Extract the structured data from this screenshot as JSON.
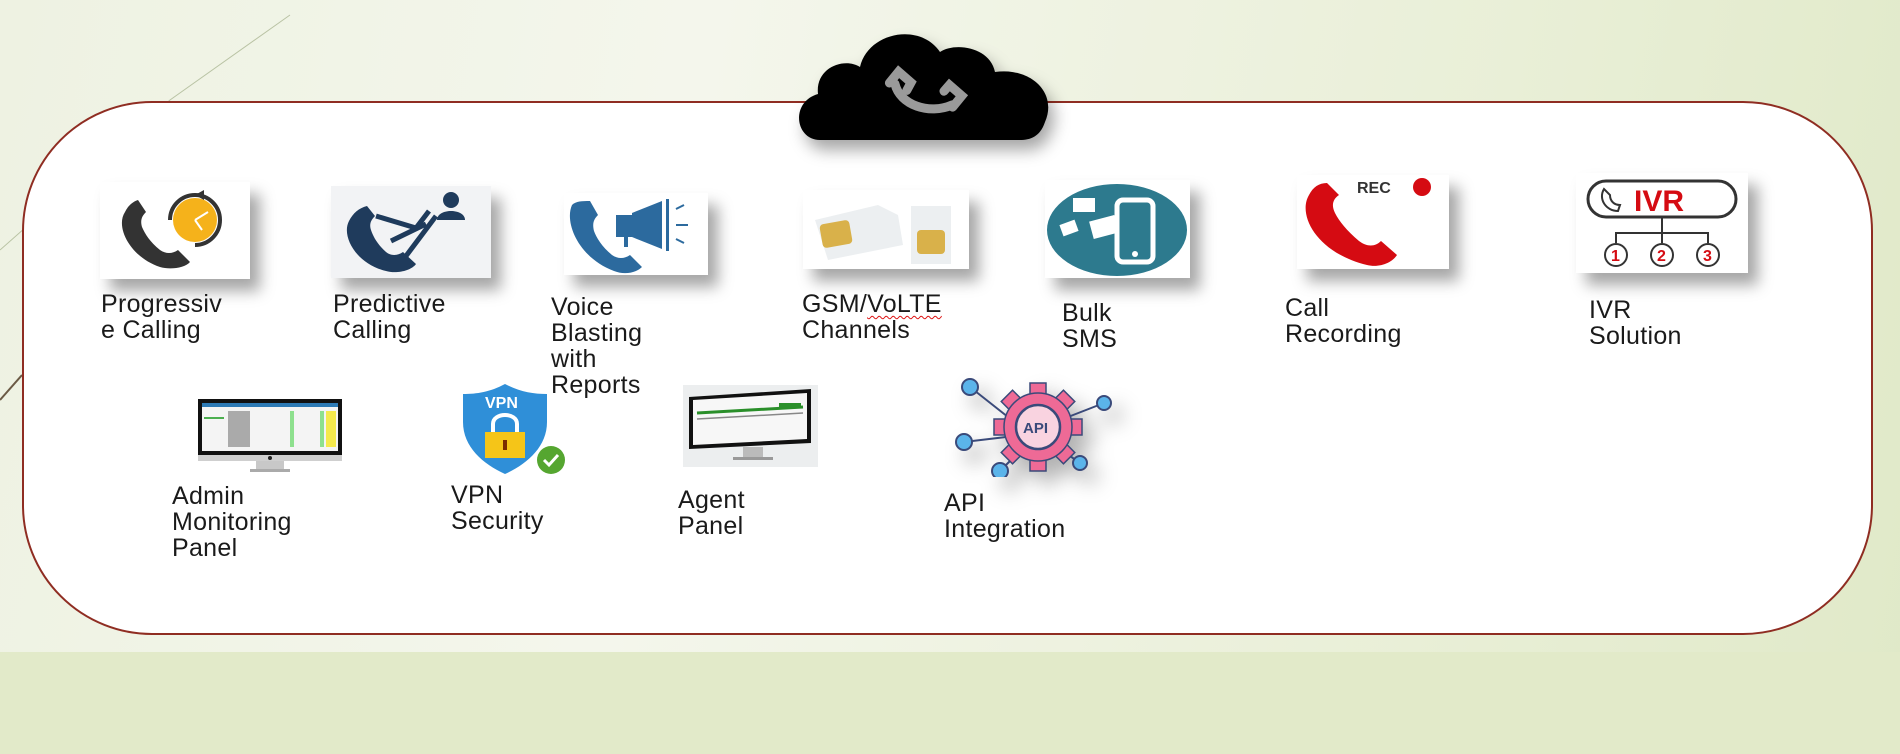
{
  "diagram": {
    "center_icon": "cloud-phone-icon",
    "colors": {
      "panel_border": "#8f2d22",
      "background": "#e8efd6",
      "panel_fill": "#ffffff",
      "label_text": "#1a1a1a"
    },
    "features_row1": [
      {
        "label": "Progressiv\ne Calling",
        "icon": "progressive-calling-icon"
      },
      {
        "label": "Predictive\nCalling",
        "icon": "predictive-calling-icon"
      },
      {
        "label": "Voice Blasting\nwith Reports",
        "icon": "voice-blasting-icon"
      },
      {
        "label_line1_a": "GSM/",
        "label_line1_b": "VoLTE",
        "label_line2": "Channels",
        "icon": "sim-card-icon"
      },
      {
        "label": "Bulk\nSMS",
        "icon": "bulk-sms-icon"
      },
      {
        "label": "Call\nRecording",
        "icon": "call-recording-icon",
        "badge": "REC"
      },
      {
        "label": "IVR\nSolution",
        "icon": "ivr-icon",
        "badge": "IVR",
        "options": [
          "1",
          "2",
          "3"
        ]
      }
    ],
    "features_row2": [
      {
        "label": "Admin Monitoring\nPanel",
        "icon": "admin-monitor-icon"
      },
      {
        "label": "VPN\nSecurity",
        "icon": "vpn-shield-icon",
        "badge": "VPN"
      },
      {
        "label": "Agent\nPanel",
        "icon": "agent-monitor-icon"
      },
      {
        "label": "API\nIntegration",
        "icon": "api-gear-icon",
        "badge": "API"
      }
    ]
  }
}
